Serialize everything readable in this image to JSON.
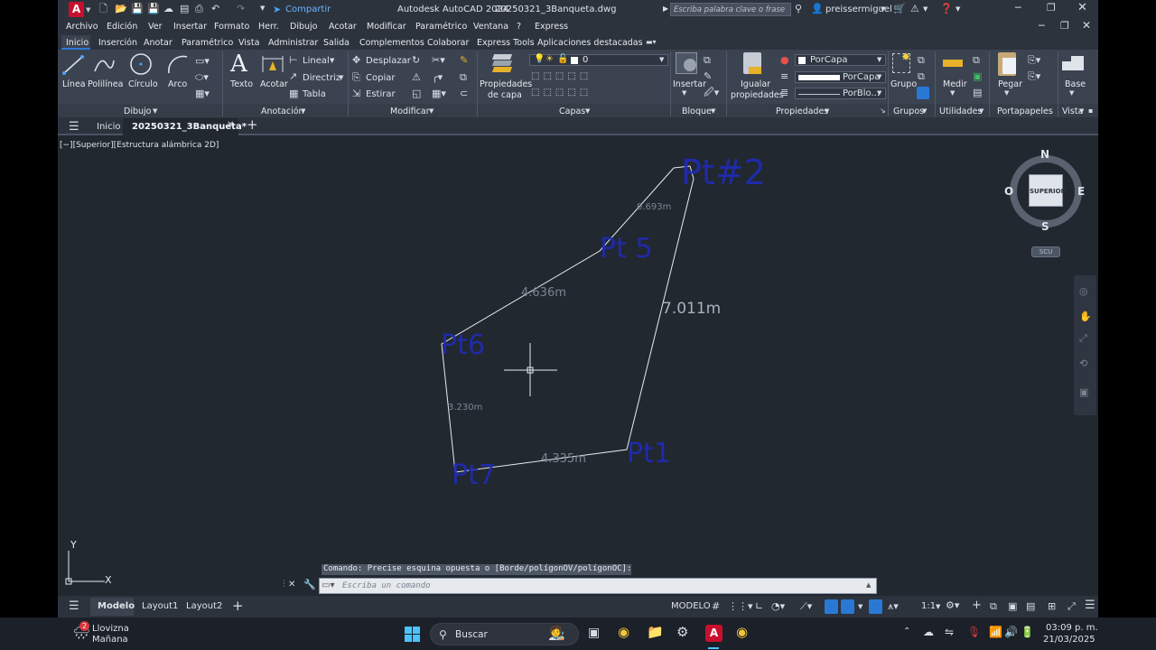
{
  "app": {
    "title": "Autodesk AutoCAD 2024",
    "file": "20250321_3Banqueta.dwg",
    "share": "Compartir",
    "search_placeholder": "Escriba palabra clave o frase",
    "user": "preissermiguel"
  },
  "menu": [
    "Archivo",
    "Edición",
    "Ver",
    "Insertar",
    "Formato",
    "Herr.",
    "Dibujo",
    "Acotar",
    "Modificar",
    "Paramétrico",
    "Ventana",
    "?",
    "Express"
  ],
  "ribbon_tabs": [
    "Inicio",
    "Inserción",
    "Anotar",
    "Paramétrico",
    "Vista",
    "Administrar",
    "Salida",
    "Complementos",
    "Colaborar",
    "Express Tools",
    "Aplicaciones destacadas"
  ],
  "ribbon": {
    "draw": {
      "line": "Línea",
      "polyline": "Polilínea",
      "circle": "Círculo",
      "arc": "Arco",
      "group": "Dibujo"
    },
    "annot": {
      "text": "Texto",
      "dim": "Acotar",
      "linear": "Lineal",
      "leader": "Directriz",
      "table": "Tabla",
      "group": "Anotación"
    },
    "modify": {
      "move": "Desplazar",
      "copy": "Copiar",
      "stretch": "Estirar",
      "group": "Modificar"
    },
    "layers": {
      "props1": "Propiedades",
      "props2": "de capa",
      "current": "0",
      "group": "Capas"
    },
    "block": {
      "insert": "Insertar",
      "group": "Bloque"
    },
    "props": {
      "match1": "Igualar",
      "match2": "propiedades",
      "color": "PorCapa",
      "lineweight": "PorCapa",
      "linetype": "PorBlo...",
      "group": "Propiedades"
    },
    "groups": {
      "group_btn": "Grupo",
      "group": "Grupos"
    },
    "utilities": {
      "measure": "Medir",
      "group": "Utilidades"
    },
    "clipboard": {
      "paste": "Pegar",
      "group": "Portapapeles"
    },
    "view": {
      "base": "Base",
      "group": "Vista"
    }
  },
  "doc_tabs": {
    "home": "Inicio",
    "active": "20250321_3Banqueta*"
  },
  "viewport_label": "[−][Superior][Estructura alámbrica 2D]",
  "drawing": {
    "labels": {
      "pt2": "Pt#2",
      "pt5": "Pt 5",
      "pt6": "Pt6",
      "pt7": "Pt7",
      "pt1": "Pt1"
    },
    "dims": {
      "d1": "0.693m",
      "d2": "4.636m",
      "d3": "7.011m",
      "d4": "3.230m",
      "d5": "4.335m"
    }
  },
  "viewcube": {
    "n": "N",
    "s": "S",
    "e": "E",
    "w": "O",
    "face": "SUPERIOR",
    "ucs": "SCU"
  },
  "ucs_axes": {
    "x": "X",
    "y": "Y"
  },
  "command": {
    "history": "Comando: Precise esquina opuesta o [Borde/polígonOV/polígonOC]:",
    "placeholder": "Escriba un comando"
  },
  "layout_tabs": [
    "Modelo",
    "Layout1",
    "Layout2"
  ],
  "status": {
    "model": "MODELO",
    "scale": "1:1"
  },
  "taskbar": {
    "weather1": "Llovizna",
    "weather2": "Mañana",
    "search": "Buscar",
    "time": "03:09 p. m.",
    "date": "21/03/2025",
    "badge": "2"
  },
  "colors": {
    "accent": "#2a78d6",
    "drawing_line": "#e8ecf2",
    "label_blue": "#1f2bb8",
    "dim_gray": "#7d8591"
  }
}
